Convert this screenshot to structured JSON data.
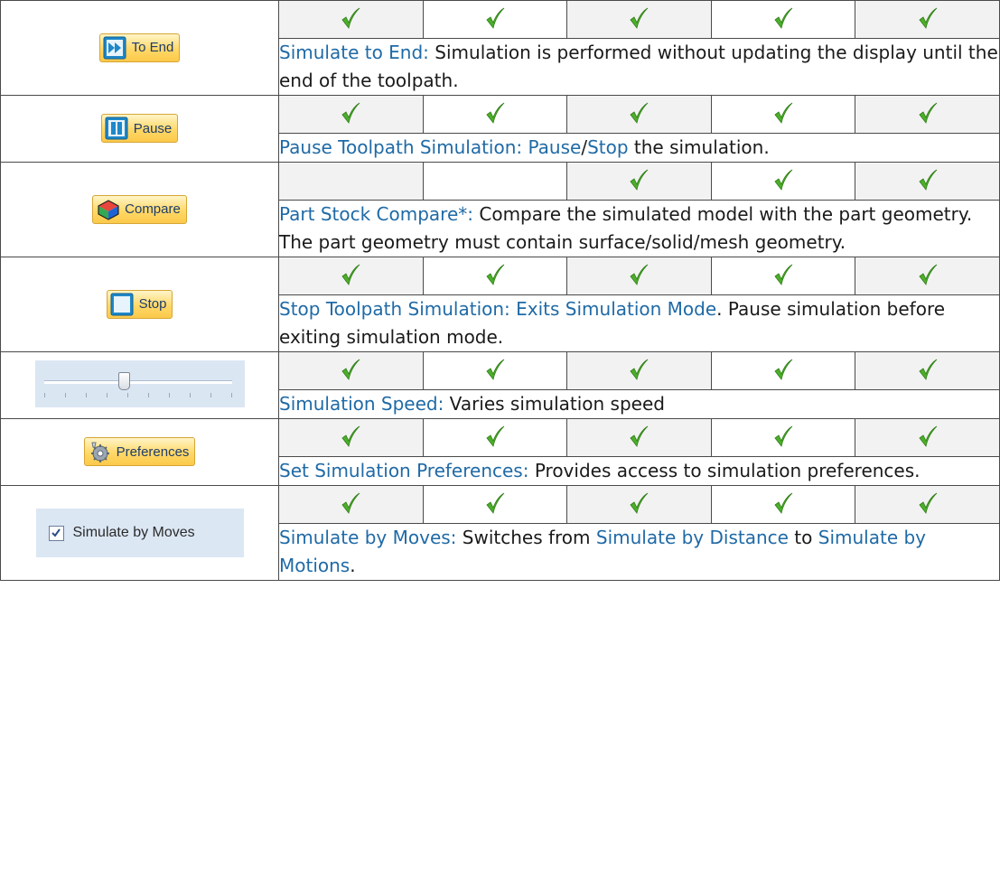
{
  "colors": {
    "link": "#1f6aa6",
    "check": "#4caf2a",
    "button_bg": "#ffd868"
  },
  "rows": [
    {
      "button": {
        "label": "To End",
        "icon": "fast-forward-icon",
        "type": "button"
      },
      "checks": [
        true,
        true,
        true,
        true,
        true
      ],
      "desc": [
        {
          "t": "Simulate to End:",
          "link": true
        },
        {
          "t": " Simulation is performed without updating the display until the end of the toolpath.",
          "link": false
        }
      ]
    },
    {
      "button": {
        "label": "Pause",
        "icon": "pause-icon",
        "type": "button"
      },
      "checks": [
        true,
        true,
        true,
        true,
        true
      ],
      "desc": [
        {
          "t": "Pause Toolpath Simulation:",
          "link": true
        },
        {
          "t": " ",
          "link": false
        },
        {
          "t": "Pause",
          "link": true
        },
        {
          "t": "/",
          "link": false
        },
        {
          "t": "Stop",
          "link": true
        },
        {
          "t": " the simulation.",
          "link": false
        }
      ]
    },
    {
      "button": {
        "label": "Compare",
        "icon": "compare-cube-icon",
        "type": "button"
      },
      "checks": [
        false,
        false,
        true,
        true,
        true
      ],
      "desc": [
        {
          "t": "Part Stock Compare*:",
          "link": true
        },
        {
          "t": " Compare the simulated model with the part geometry. The part geometry must contain surface/solid/mesh geometry.",
          "link": false
        }
      ]
    },
    {
      "button": {
        "label": "Stop",
        "icon": "stop-icon",
        "type": "button"
      },
      "checks": [
        true,
        true,
        true,
        true,
        true
      ],
      "desc": [
        {
          "t": "Stop Toolpath Simulation:",
          "link": true
        },
        {
          "t": " ",
          "link": false
        },
        {
          "t": "Exits Simulation Mode",
          "link": true
        },
        {
          "t": ". Pause simulation before exiting simulation mode.",
          "link": false
        }
      ]
    },
    {
      "button": {
        "label": "",
        "icon": "speed-slider-icon",
        "type": "slider",
        "value": 0.42
      },
      "checks": [
        true,
        true,
        true,
        true,
        true
      ],
      "desc": [
        {
          "t": "Simulation Speed:",
          "link": true
        },
        {
          "t": " Varies simulation speed",
          "link": false
        }
      ]
    },
    {
      "button": {
        "label": "Preferences",
        "icon": "gear-preferences-icon",
        "type": "button"
      },
      "checks": [
        true,
        true,
        true,
        true,
        true
      ],
      "desc": [
        {
          "t": "Set Simulation Preferences:",
          "link": true
        },
        {
          "t": " Provides access to simulation preferences.",
          "link": false
        }
      ]
    },
    {
      "button": {
        "label": "Simulate by Moves",
        "icon": "checkbox-icon",
        "type": "checkbox",
        "checked": true
      },
      "checks": [
        true,
        true,
        true,
        true,
        true
      ],
      "desc": [
        {
          "t": "Simulate by Moves:",
          "link": true
        },
        {
          "t": " Switches from ",
          "link": false
        },
        {
          "t": "Simulate by Distance",
          "link": true
        },
        {
          "t": " to ",
          "link": false
        },
        {
          "t": "Simulate by Motions",
          "link": true
        },
        {
          "t": ".",
          "link": false
        }
      ]
    }
  ]
}
